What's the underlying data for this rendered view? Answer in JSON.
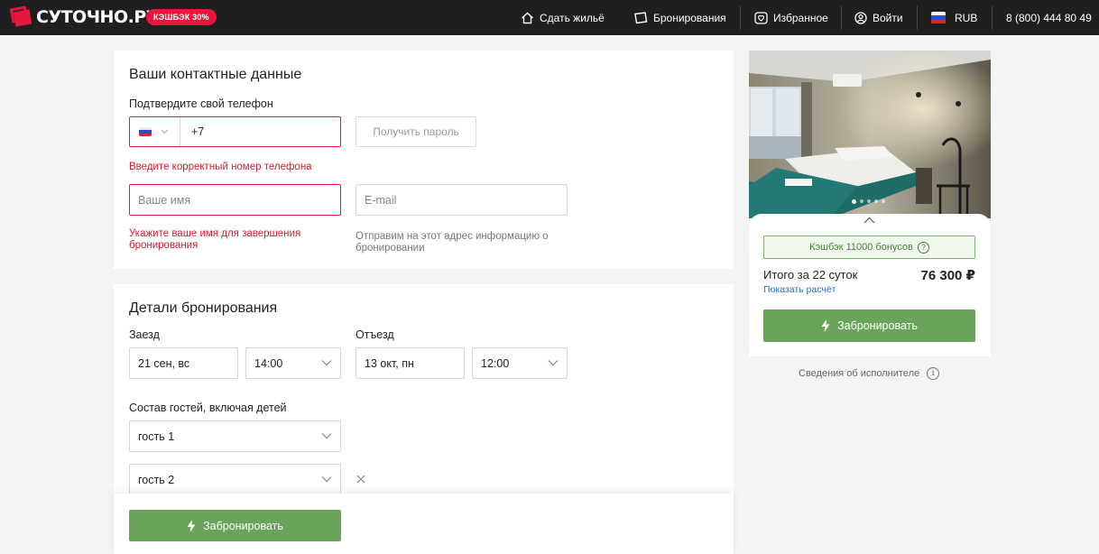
{
  "header": {
    "logo_text": "СУТОЧНО.РУ",
    "cashback_badge": "КЭШБЭК 30%",
    "nav": {
      "rent_out": "Сдать жильё",
      "bookings": "Бронирования",
      "favorites": "Избранное",
      "login": "Войти",
      "currency": "RUB",
      "phone": "8 (800) 444 80 49"
    }
  },
  "contacts": {
    "title": "Ваши контактные данные",
    "phone_label": "Подтвердите свой телефон",
    "phone_prefix": "+7",
    "get_password_label": "Получить пароль",
    "phone_error": "Введите корректный номер телефона",
    "name_placeholder": "Ваше имя",
    "email_placeholder": "E-mail",
    "name_error": "Укажите ваше имя для завершения бронирования",
    "email_hint": "Отправим на этот адрес информацию о бронировании"
  },
  "booking": {
    "title": "Детали бронирования",
    "checkin_label": "Заезд",
    "checkin_date": "21 сен, вс",
    "checkin_time": "14:00",
    "checkout_label": "Отъезд",
    "checkout_date": "13 окт, пн",
    "checkout_time": "12:00",
    "guests_label": "Состав гостей, включая детей",
    "guests": [
      "гость 1",
      "гость 2"
    ]
  },
  "summary": {
    "cashback": "Кэшбэк  11000 бонусов",
    "total_label": "Итого за 22 суток",
    "total_price": "76 300 ₽",
    "show_calc": "Показать расчёт",
    "book_label": "Забронировать",
    "provider_info": "Сведения об исполнителе",
    "photo_count": 5,
    "photo_active": 1
  },
  "sticky": {
    "book_label": "Забронировать"
  },
  "colors": {
    "brand_red": "#e8163c",
    "green": "#6aa35a",
    "header_bg": "#1f1f1f",
    "link_blue": "#2a6ec7"
  }
}
